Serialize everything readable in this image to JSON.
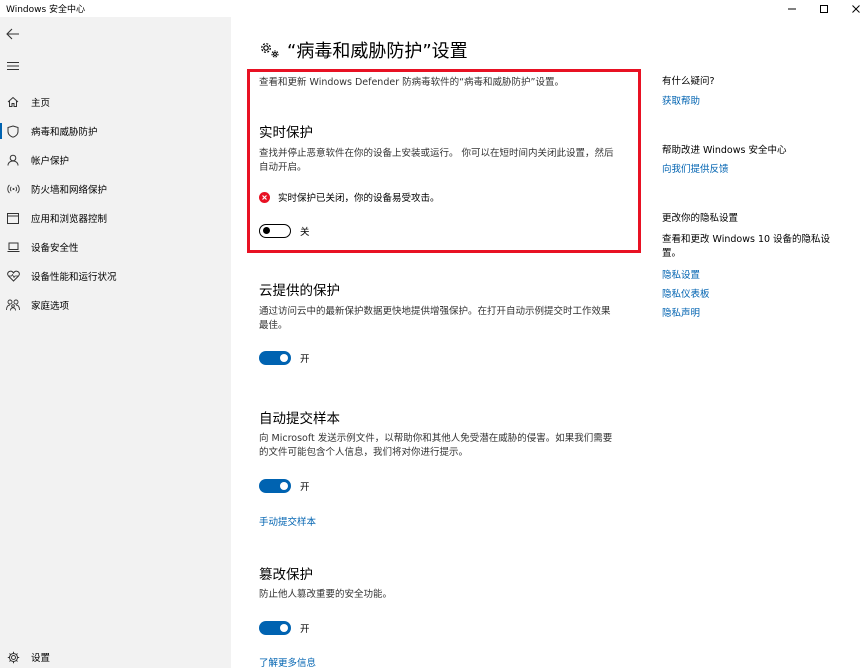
{
  "window": {
    "title": "Windows 安全中心",
    "minimize_glyph": "—",
    "maximize_glyph": "☐",
    "close_glyph": "✕"
  },
  "sidebar": {
    "back_icon": "back-arrow-icon",
    "menu_icon": "hamburger-menu-icon",
    "items": [
      {
        "label": "主页",
        "icon": "home-icon",
        "active": false
      },
      {
        "label": "病毒和威胁防护",
        "icon": "shield-icon",
        "active": true
      },
      {
        "label": "帐户保护",
        "icon": "person-icon",
        "active": false
      },
      {
        "label": "防火墙和网络保护",
        "icon": "wifi-signal-icon",
        "active": false
      },
      {
        "label": "应用和浏览器控制",
        "icon": "browser-window-icon",
        "active": false
      },
      {
        "label": "设备安全性",
        "icon": "laptop-icon",
        "active": false
      },
      {
        "label": "设备性能和运行状况",
        "icon": "heart-icon",
        "active": false
      },
      {
        "label": "家庭选项",
        "icon": "family-icon",
        "active": false
      }
    ],
    "settings": {
      "label": "设置",
      "icon": "gear-icon"
    }
  },
  "main": {
    "title": "“病毒和威胁防护”设置",
    "title_icon": "gears-icon",
    "subtitle": "查看和更新 Windows Defender 防病毒软件的“病毒和威胁防护”设置。",
    "realtime": {
      "title": "实时保护",
      "desc": "查找并停止恶意软件在你的设备上安装或运行。 你可以在短时间内关闭此设置，然后自动开启。",
      "warning": "实时保护已关闭，你的设备易受攻击。",
      "warning_icon": "error-circle-icon",
      "toggle_state": "关"
    },
    "cloud": {
      "title": "云提供的保护",
      "desc": "通过访问云中的最新保护数据更快地提供增强保护。在打开自动示例提交时工作效果最佳。",
      "toggle_state": "开"
    },
    "sample": {
      "title": "自动提交样本",
      "desc": "向 Microsoft 发送示例文件，以帮助你和其他人免受潜在威胁的侵害。如果我们需要的文件可能包含个人信息，我们将对你进行提示。",
      "toggle_state": "开",
      "link": "手动提交样本"
    },
    "tamper": {
      "title": "篡改保护",
      "desc": "防止他人篡改重要的安全功能。",
      "toggle_state": "开",
      "link": "了解更多信息"
    }
  },
  "right": {
    "q_heading": "有什么疑问?",
    "q_link": "获取帮助",
    "improve_heading": "帮助改进 Windows 安全中心",
    "improve_link": "向我们提供反馈",
    "privacy_heading": "更改你的隐私设置",
    "privacy_text": "查看和更改 Windows 10 设备的隐私设置。",
    "privacy_links": [
      "隐私设置",
      "隐私仪表板",
      "隐私声明"
    ]
  },
  "colors": {
    "accent": "#0063b1",
    "highlight": "#e81123",
    "sidebar_bg": "#f2f2f2"
  }
}
